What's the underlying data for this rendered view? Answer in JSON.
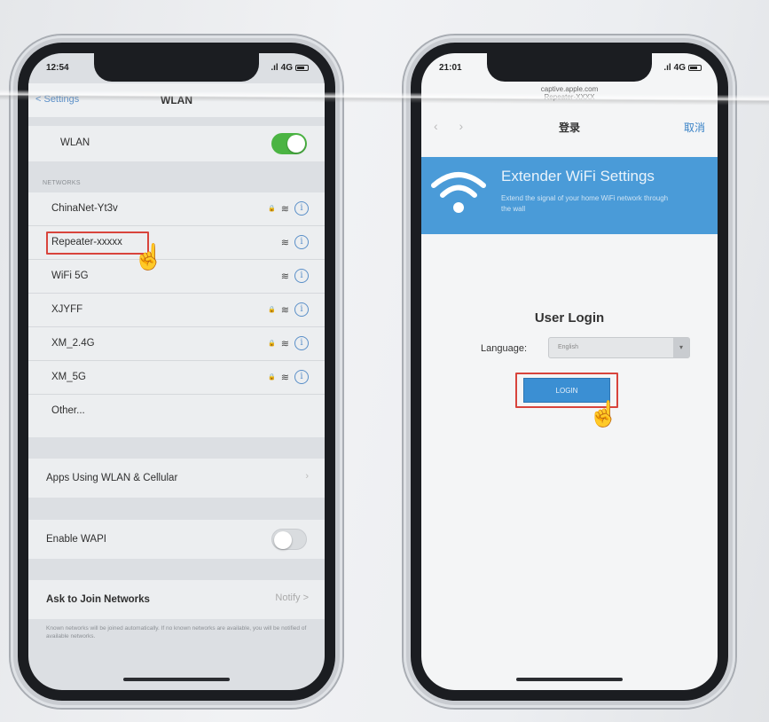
{
  "left_phone": {
    "status": {
      "time": "12:54",
      "signal": "4G"
    },
    "nav": {
      "back": "< Settings",
      "title": "WLAN"
    },
    "wlan_row": {
      "label": "WLAN",
      "toggle_on": true
    },
    "networks_header": "NETWORKS",
    "networks": [
      {
        "name": "ChinaNet-Yt3v",
        "locked": true
      },
      {
        "name": "Repeater-xxxxx",
        "locked": false,
        "highlighted": true
      },
      {
        "name": "WiFi 5G",
        "locked": false
      },
      {
        "name": "XJYFF",
        "locked": true
      },
      {
        "name": "XM_2.4G",
        "locked": true
      },
      {
        "name": "XM_5G",
        "locked": true
      }
    ],
    "other_label": "Other...",
    "apps_row": "Apps Using WLAN & Cellular",
    "wapi_row": {
      "label": "Enable WAPI",
      "toggle_on": false
    },
    "ask_row": {
      "label": "Ask to Join Networks",
      "value": "Notify >"
    },
    "footnote": "Known networks will be joined automatically. If no known networks are available, you will be notified of available networks."
  },
  "right_phone": {
    "status": {
      "time": "21:01",
      "signal": "4G"
    },
    "browser": {
      "url": "captive.apple.com",
      "subtitle": "Repeater-XXXX"
    },
    "nav": {
      "title": "登录",
      "cancel": "取消"
    },
    "banner": {
      "title": "Extender WiFi Settings",
      "description": "Extend the signal of your home WiFi network through the wall",
      "color": "#4a9bd8"
    },
    "login": {
      "title": "User Login",
      "language_label": "Language:",
      "language_value": "English",
      "button": "LOGIN"
    }
  },
  "colors": {
    "toggle_on": "#4bb443",
    "highlight": "#d8443c",
    "link": "#3a83c7"
  }
}
